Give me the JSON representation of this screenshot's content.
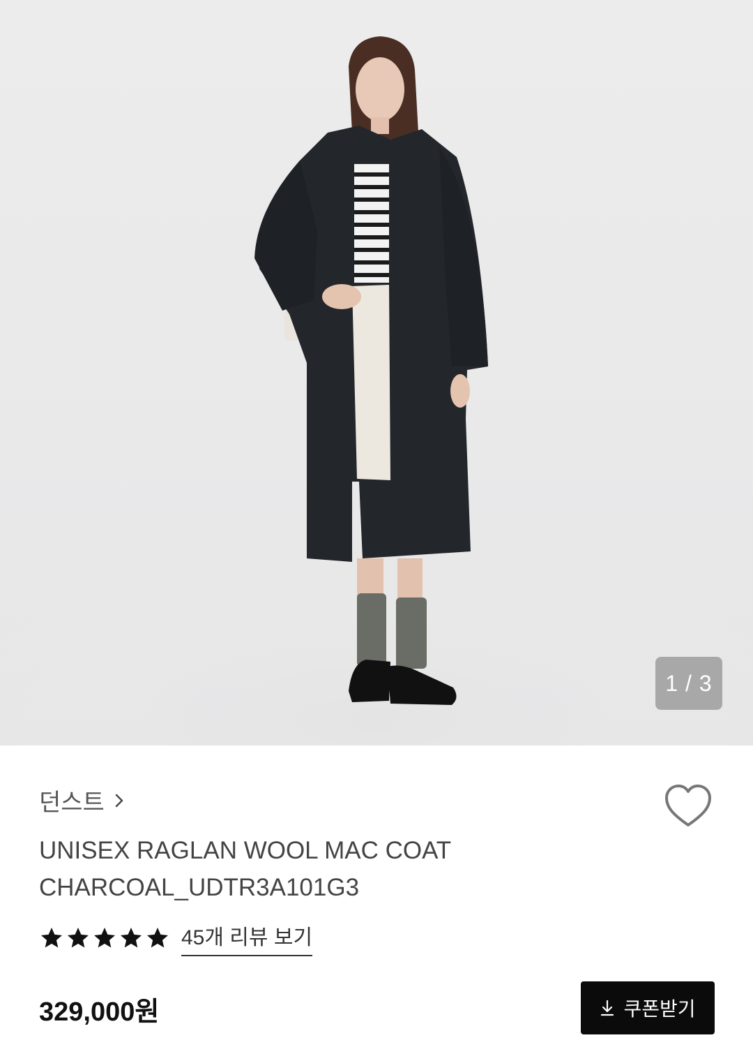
{
  "gallery": {
    "counter": "1 / 3"
  },
  "product": {
    "brand": "던스트",
    "title_line1": "UNISEX RAGLAN WOOL MAC COAT",
    "title_line2": "CHARCOAL_UDTR3A101G3",
    "rating_stars": 5,
    "review_link": "45개 리뷰 보기",
    "price": "329,000원"
  },
  "actions": {
    "coupon_label": "쿠폰받기",
    "wishlist_icon": "heart-icon",
    "download_icon": "download-icon",
    "brand_link_icon": "chevron-right-icon"
  }
}
